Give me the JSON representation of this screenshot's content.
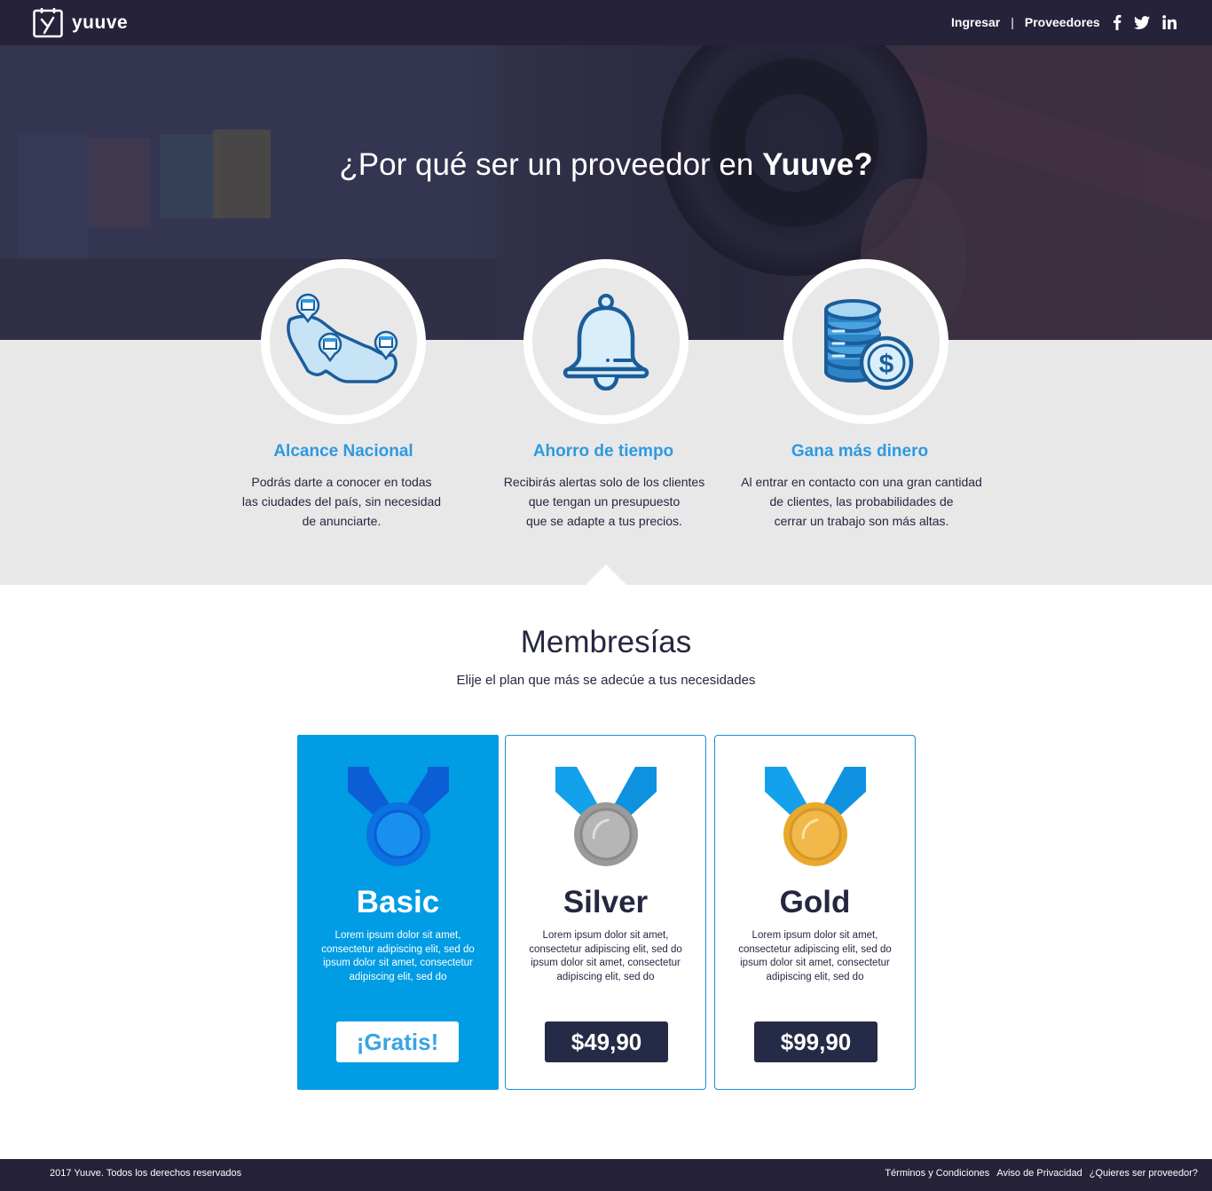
{
  "navbar": {
    "brand": "yuuve",
    "links": [
      "Ingresar",
      "|",
      "Proveedores"
    ],
    "social": [
      "facebook-icon",
      "twitter-icon",
      "linkedin-icon"
    ]
  },
  "hero": {
    "title_prefix": "¿Por qué ser un proveedor en ",
    "title_brand": "Yuuve?"
  },
  "features": [
    {
      "icon": "map-pins-icon",
      "title": "Alcance Nacional",
      "text": "Podrás darte a conocer en todas\nlas ciudades del país, sin necesidad\nde anunciarte."
    },
    {
      "icon": "bell-icon",
      "title": "Ahorro de tiempo",
      "text": "Recibirás alertas solo de los clientes\nque tengan un presupuesto\nque se adapte a tus precios."
    },
    {
      "icon": "coins-icon",
      "title": "Gana más dinero",
      "text": "Al entrar en contacto con una gran cantidad\nde clientes,  las probabilidades de\ncerrar un trabajo son más altas."
    }
  ],
  "memberships": {
    "title": "Membresías",
    "subtitle": "Elije el plan que más se adecúe a tus necesidades",
    "plans": [
      {
        "name": "Basic",
        "description": "Lorem ipsum dolor sit amet,\nconsectetur adipiscing elit, sed do\nipsum  dolor sit amet, consectetur\nadipiscing  elit, sed do",
        "price": "¡Gratis!"
      },
      {
        "name": "Silver",
        "description": "Lorem ipsum dolor sit amet,\nconsectetur adipiscing elit, sed do\nipsum  dolor sit amet, consectetur\nadipiscing  elit, sed do",
        "price": "$49,90"
      },
      {
        "name": "Gold",
        "description": "Lorem ipsum dolor sit amet,\nconsectetur adipiscing elit, sed do\nipsum  dolor sit amet, consectetur\nadipiscing  elit, sed do",
        "price": "$99,90"
      }
    ]
  },
  "footer": {
    "copyright": "2017 Yuuve.  Todos los derechos reservados",
    "links": [
      "Términos y Condiciones",
      "Aviso de Privacidad",
      "¿Quieres ser proveedor?"
    ]
  },
  "colors": {
    "navy": "#25223a",
    "accent_blue": "#009ce4",
    "feature_title_blue": "#2d9ae0",
    "gray_band": "#e8e8e9",
    "price_button": "#252a46"
  }
}
